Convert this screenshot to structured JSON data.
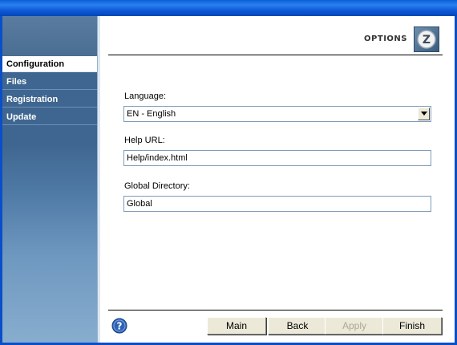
{
  "header": {
    "title": "OPTIONS",
    "logo_letter": "Z"
  },
  "sidebar": {
    "items": [
      {
        "label": "Configuration",
        "active": true
      },
      {
        "label": "Files",
        "active": false
      },
      {
        "label": "Registration",
        "active": false
      },
      {
        "label": "Update",
        "active": false
      }
    ]
  },
  "form": {
    "language": {
      "label": "Language:",
      "value": "EN - English"
    },
    "help_url": {
      "label": "Help URL:",
      "value": "Help/index.html"
    },
    "global_directory": {
      "label": "Global Directory:",
      "value": "Global"
    }
  },
  "footer": {
    "buttons": {
      "main": "Main",
      "back": "Back",
      "apply": "Apply",
      "finish": "Finish"
    },
    "apply_disabled": true
  },
  "colors": {
    "titlebar": "#0a5fd6",
    "sidebar": "#3f6690",
    "button_face": "#ece9d8",
    "help_icon": "#2d62b4"
  },
  "icons": {
    "help": "help-icon",
    "dropdown": "chevron-down-icon",
    "logo": "z-logo-icon"
  }
}
